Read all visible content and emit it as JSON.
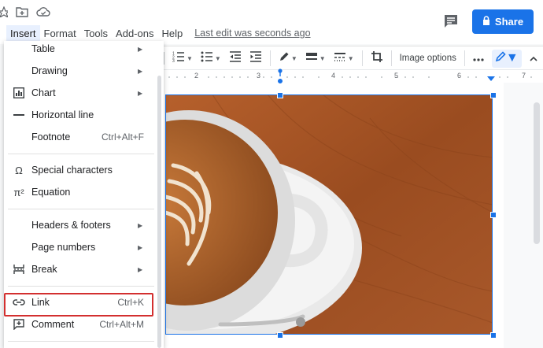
{
  "menubar": {
    "items": [
      "Insert",
      "Format",
      "Tools",
      "Add-ons",
      "Help"
    ],
    "last_edit": "Last edit was seconds ago"
  },
  "share": {
    "label": "Share"
  },
  "toolbar": {
    "image_options": "Image options"
  },
  "ruler": {
    "ticks": [
      "2",
      "3",
      "4",
      "5",
      "6",
      "7"
    ]
  },
  "insert_menu": {
    "items": [
      {
        "label": "Table",
        "submenu": true
      },
      {
        "label": "Drawing",
        "submenu": true
      },
      {
        "label": "Chart",
        "submenu": true,
        "icon": "chart-icon"
      },
      {
        "label": "Horizontal line",
        "icon": "horizontal-line-icon"
      },
      {
        "label": "Footnote",
        "shortcut": "Ctrl+Alt+F"
      },
      {
        "label": "Special characters",
        "icon": "omega-icon"
      },
      {
        "label": "Equation",
        "icon": "pi-icon"
      },
      {
        "label": "Headers & footers",
        "submenu": true
      },
      {
        "label": "Page numbers",
        "submenu": true
      },
      {
        "label": "Break",
        "submenu": true,
        "icon": "break-icon"
      },
      {
        "label": "Link",
        "shortcut": "Ctrl+K",
        "icon": "link-icon",
        "highlighted": true
      },
      {
        "label": "Comment",
        "shortcut": "Ctrl+Alt+M",
        "icon": "add-comment-icon"
      }
    ]
  },
  "colors": {
    "accent": "#1a73e8",
    "highlight_border": "#d32f2f"
  }
}
